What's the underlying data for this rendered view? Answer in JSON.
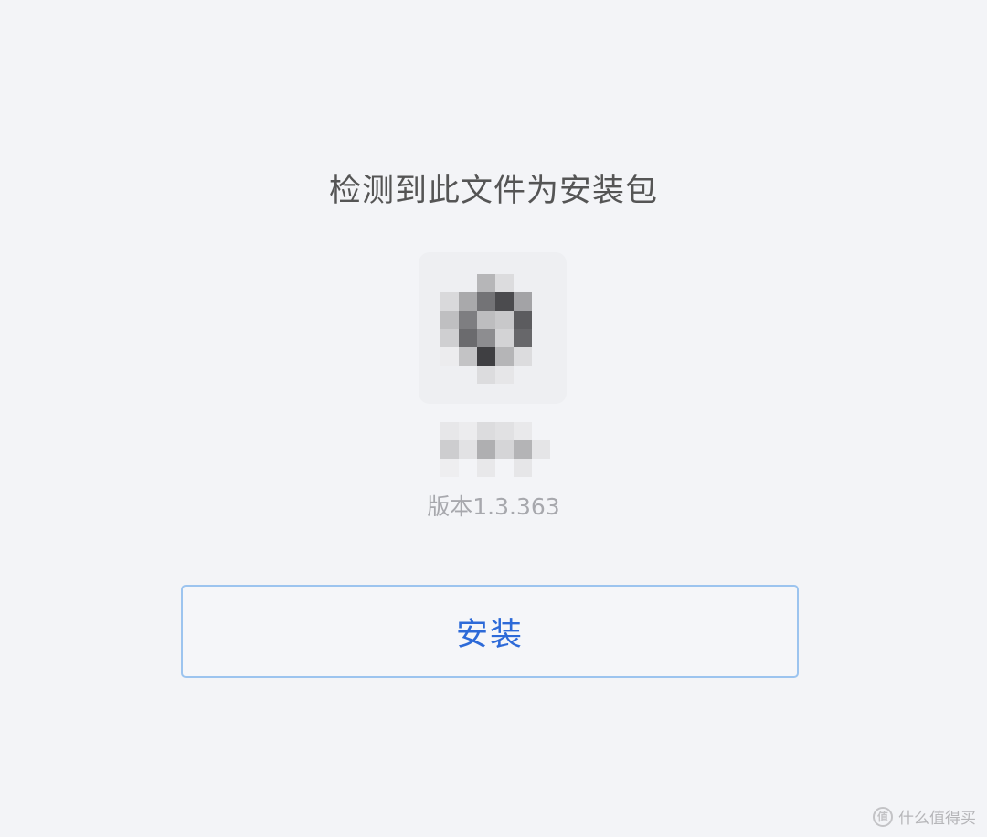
{
  "dialog": {
    "title": "检测到此文件为安装包",
    "version_text": "版本1.3.363",
    "install_label": "安装"
  },
  "watermark": {
    "logo_char": "值",
    "text": "什么值得买"
  },
  "colors": {
    "background": "#f3f4f7",
    "title": "#555555",
    "version": "#a7a8ad",
    "accent": "#2d6ad8",
    "button_border": "#9cc4ef"
  },
  "icons": {
    "app_icon": "pixelated-app-icon",
    "app_name": "pixelated-app-name"
  }
}
